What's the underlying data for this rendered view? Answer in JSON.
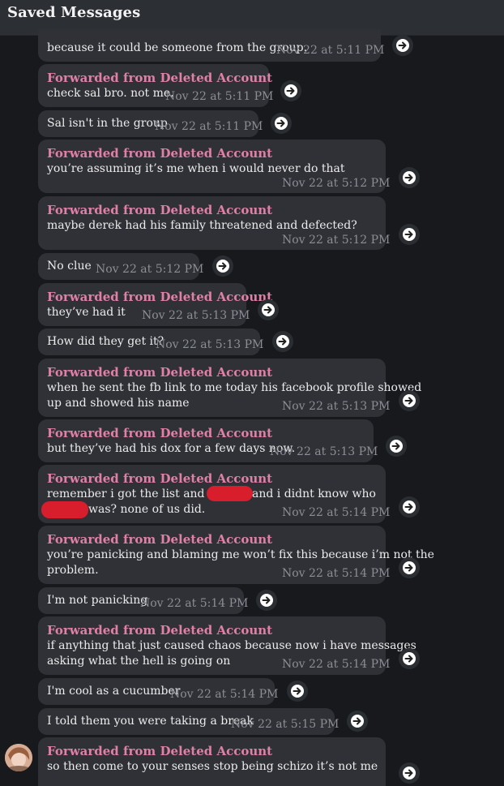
{
  "header": {
    "title": "Saved Messages"
  },
  "messages": [
    {
      "forwarded": "",
      "lines": [
        "because it could be someone from the group."
      ],
      "time": "Nov 22 at 5:11 PM"
    },
    {
      "forwarded": "Forwarded from Deleted Account",
      "lines": [
        "check sal bro. not me."
      ],
      "time": "Nov 22 at 5:11 PM"
    },
    {
      "forwarded": "",
      "lines": [
        "Sal isn't in the group"
      ],
      "time": "Nov 22 at 5:11 PM"
    },
    {
      "forwarded": "Forwarded from Deleted Account",
      "lines": [
        "you’re assuming it’s me when i would never do that"
      ],
      "time": "Nov 22 at 5:12 PM"
    },
    {
      "forwarded": "Forwarded from Deleted Account",
      "lines": [
        "maybe derek had his family threatened and defected?"
      ],
      "time": "Nov 22 at 5:12 PM"
    },
    {
      "forwarded": "",
      "lines": [
        "No clue"
      ],
      "time": "Nov 22 at 5:12 PM"
    },
    {
      "forwarded": "Forwarded from Deleted Account",
      "lines": [
        "they’ve had it"
      ],
      "time": "Nov 22 at 5:13 PM"
    },
    {
      "forwarded": "",
      "lines": [
        "How did they get it?"
      ],
      "time": "Nov 22 at 5:13 PM"
    },
    {
      "forwarded": "Forwarded from Deleted Account",
      "lines": [
        "when he sent the fb link to me today his facebook profile showed",
        "up and showed his name"
      ],
      "time": "Nov 22 at 5:13 PM"
    },
    {
      "forwarded": "Forwarded from Deleted Account",
      "lines": [
        "but they’ve had his dox for a few days now."
      ],
      "time": "Nov 22 at 5:13 PM"
    },
    {
      "forwarded": "Forwarded from Deleted Account",
      "lines": [
        "remember i got the list and it said",
        "and i didnt know who",
        "was? none of us did."
      ],
      "time": "Nov 22 at 5:14 PM"
    },
    {
      "forwarded": "Forwarded from Deleted Account",
      "lines": [
        "you’re panicking and blaming me won’t fix this because i’m not the",
        "problem."
      ],
      "time": "Nov 22 at 5:14 PM"
    },
    {
      "forwarded": "",
      "lines": [
        "I'm not panicking"
      ],
      "time": "Nov 22 at 5:14 PM"
    },
    {
      "forwarded": "Forwarded from Deleted Account",
      "lines": [
        "if anything that just caused chaos because now i have messages",
        "asking what the hell is going on"
      ],
      "time": "Nov 22 at 5:14 PM"
    },
    {
      "forwarded": "",
      "lines": [
        "I'm cool as a cucumber"
      ],
      "time": "Nov 22 at 5:14 PM"
    },
    {
      "forwarded": "",
      "lines": [
        "I told them you were taking a break"
      ],
      "time": "Nov 22 at 5:15 PM"
    },
    {
      "forwarded": "Forwarded from Deleted Account",
      "lines": [
        "so then come to your senses stop being schizo it’s not me"
      ],
      "time": ""
    }
  ],
  "icons": {
    "forward": "forward-arrow-icon",
    "avatar": "avatar"
  },
  "colors": {
    "background": "#18191d",
    "bubble": "#303136",
    "forwarded_name": "#e07fa8",
    "timestamp": "#8a8e95",
    "redaction": "#d81d2c"
  }
}
